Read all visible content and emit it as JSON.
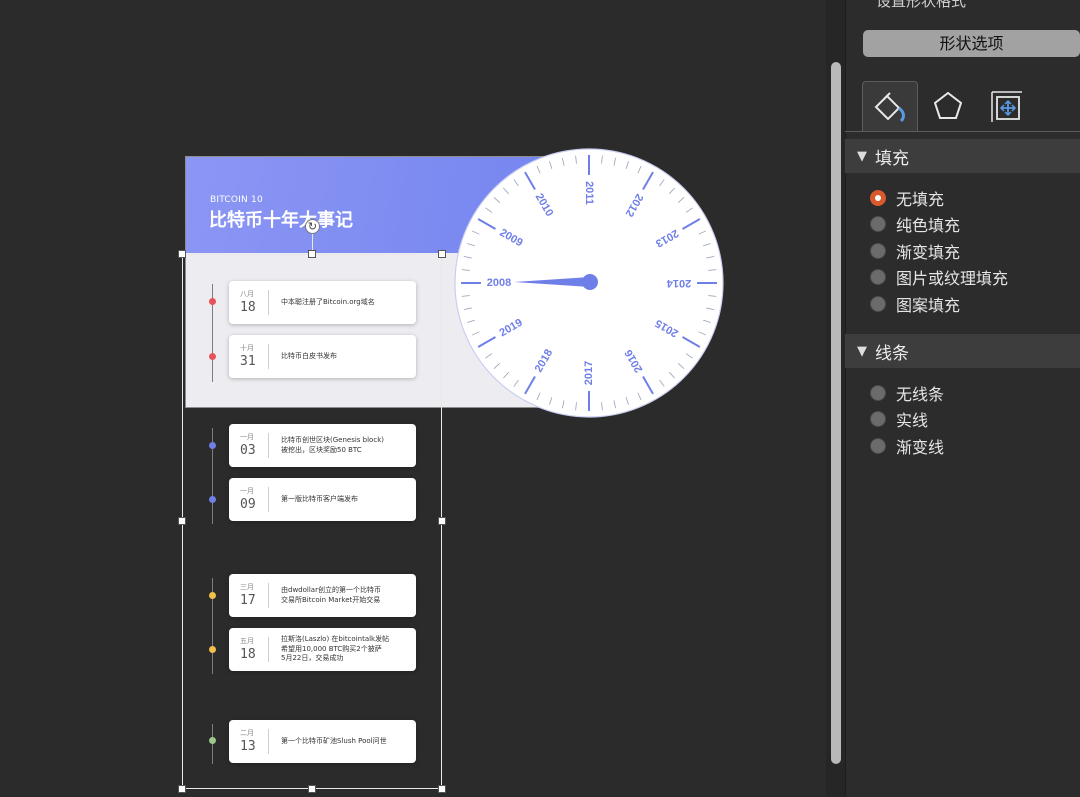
{
  "slide": {
    "brand": "BITCOIN 10",
    "title": "比特币十年大事记"
  },
  "events": [
    {
      "month": "八月",
      "day": "18",
      "text": "中本聪注册了Bitcoin.org域名",
      "dot_color": "#e8525a"
    },
    {
      "month": "十月",
      "day": "31",
      "text": "比特币白皮书发布",
      "dot_color": "#e8525a"
    },
    {
      "month": "一月",
      "day": "03",
      "text": "比特币创世区块(Genesis block)\n被挖出，区块奖励50 BTC",
      "dot_color": "#6f7fe8"
    },
    {
      "month": "一月",
      "day": "09",
      "text": "第一版比特币客户端发布",
      "dot_color": "#6f7fe8"
    },
    {
      "month": "三月",
      "day": "17",
      "text": "由dwdollar创立的第一个比特币\n交易所Bitcoin Market开始交易",
      "dot_color": "#f0c04a"
    },
    {
      "month": "五月",
      "day": "18",
      "text": "拉斯洛(Laszlo) 在bitcointalk发帖\n希望用10,000 BTC购买2个披萨\n5月22日，交易成功",
      "dot_color": "#f0c04a"
    },
    {
      "month": "二月",
      "day": "13",
      "text": "第一个比特币矿池Slush Pool问世",
      "dot_color": "#9cc88a"
    }
  ],
  "dial": {
    "years": [
      "2008",
      "2009",
      "2010",
      "2011",
      "2012",
      "2013",
      "2014",
      "2015",
      "2016",
      "2017",
      "2018",
      "2019"
    ],
    "pointer_year": "2008",
    "accent": "#6f7fe8"
  },
  "panel": {
    "top_text": "设置形状格式",
    "shape_options": "形状选项",
    "tabs": [
      "fill-line-icon",
      "effects-pentagon-icon",
      "size-properties-icon"
    ],
    "fill": {
      "heading": "填充",
      "options": [
        "无填充",
        "纯色填充",
        "渐变填充",
        "图片或纹理填充",
        "图案填充"
      ],
      "selected": "无填充"
    },
    "line": {
      "heading": "线条",
      "options": [
        "无线条",
        "实线",
        "渐变线"
      ],
      "selected": ""
    },
    "accent": "#d95a2d"
  }
}
